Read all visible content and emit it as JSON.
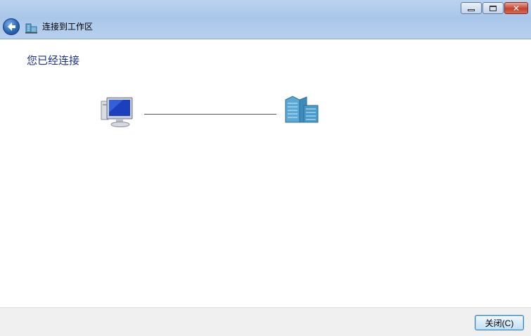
{
  "window": {
    "title": "连接到工作区",
    "controls": {
      "minimize_icon": "minimize-icon",
      "maximize_icon": "maximize-icon",
      "close_glyph": "✕"
    }
  },
  "content": {
    "heading": "您已经连接"
  },
  "diagram": {
    "left_icon": "computer-icon",
    "right_icon": "workplace-network-icon"
  },
  "footer": {
    "close_label": "关闭(C)"
  },
  "colors": {
    "heading": "#1e3287",
    "titlebar": "#b8d0ee",
    "footer": "#f0f0f0"
  }
}
